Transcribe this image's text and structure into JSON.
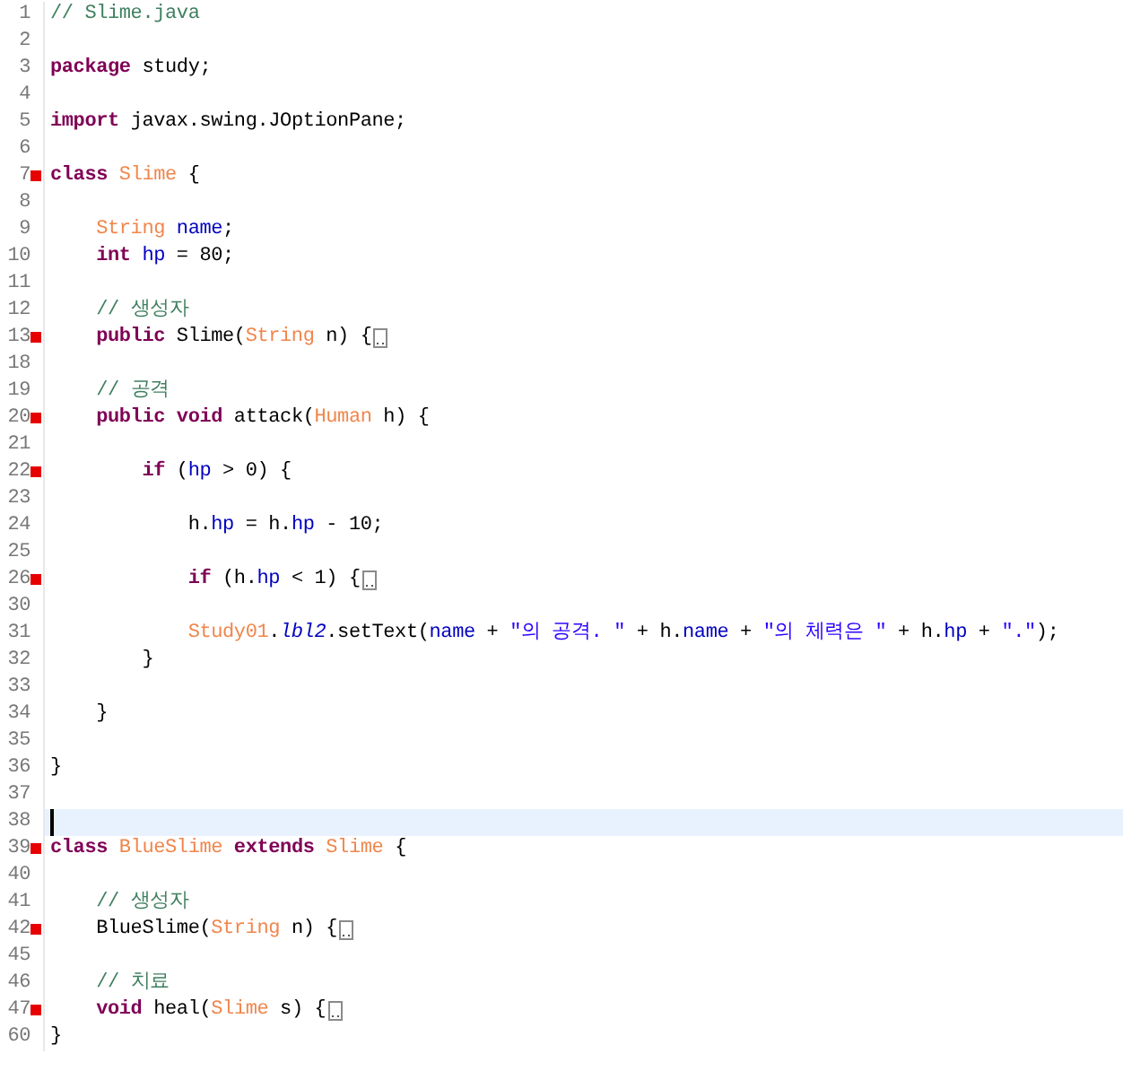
{
  "lines": [
    {
      "number": "1",
      "tokens": [
        {
          "text": "// Slime.java",
          "kind": "comment"
        }
      ]
    },
    {
      "number": "2"
    },
    {
      "number": "3",
      "tokens": [
        {
          "text": "package",
          "kind": "keyword"
        },
        {
          "text": " study;",
          "kind": "plain"
        }
      ]
    },
    {
      "number": "4"
    },
    {
      "number": "5",
      "tokens": [
        {
          "text": "import",
          "kind": "keyword"
        },
        {
          "text": " javax.swing.JOptionPane;",
          "kind": "plain"
        }
      ]
    },
    {
      "number": "6"
    },
    {
      "number": "7",
      "marker": true,
      "tokens": [
        {
          "text": "class",
          "kind": "keyword"
        },
        {
          "text": " Slime",
          "kind": "type"
        },
        {
          "text": " {",
          "kind": "plain"
        }
      ]
    },
    {
      "number": "8"
    },
    {
      "number": "9",
      "tokens": [
        {
          "text": "    String",
          "kind": "type"
        },
        {
          "text": " name",
          "kind": "field"
        },
        {
          "text": ";",
          "kind": "plain"
        }
      ]
    },
    {
      "number": "10",
      "tokens": [
        {
          "text": "    int",
          "kind": "keyword"
        },
        {
          "text": " hp",
          "kind": "field"
        },
        {
          "text": " = 80;",
          "kind": "plain"
        }
      ]
    },
    {
      "number": "11"
    },
    {
      "number": "12",
      "tokens": [
        {
          "text": "    // 생성자",
          "kind": "comment"
        }
      ]
    },
    {
      "number": "13",
      "marker": true,
      "folded": true,
      "tokens": [
        {
          "text": "    public",
          "kind": "keyword"
        },
        {
          "text": " Slime(",
          "kind": "plain"
        },
        {
          "text": "String",
          "kind": "type"
        },
        {
          "text": " n) {",
          "kind": "plain"
        }
      ]
    },
    {
      "number": "18"
    },
    {
      "number": "19",
      "tokens": [
        {
          "text": "    // 공격",
          "kind": "comment"
        }
      ]
    },
    {
      "number": "20",
      "marker": true,
      "tokens": [
        {
          "text": "    public",
          "kind": "keyword"
        },
        {
          "text": " void",
          "kind": "keyword"
        },
        {
          "text": " attack(",
          "kind": "plain"
        },
        {
          "text": "Human",
          "kind": "type"
        },
        {
          "text": " h) {",
          "kind": "plain"
        }
      ]
    },
    {
      "number": "21"
    },
    {
      "number": "22",
      "marker": true,
      "tokens": [
        {
          "text": "        if",
          "kind": "keyword"
        },
        {
          "text": " (",
          "kind": "plain"
        },
        {
          "text": "hp",
          "kind": "field"
        },
        {
          "text": " > 0) {",
          "kind": "plain"
        }
      ]
    },
    {
      "number": "23"
    },
    {
      "number": "24",
      "tokens": [
        {
          "text": "            h.",
          "kind": "plain"
        },
        {
          "text": "hp",
          "kind": "field"
        },
        {
          "text": " = h.",
          "kind": "plain"
        },
        {
          "text": "hp",
          "kind": "field"
        },
        {
          "text": " - 10;",
          "kind": "plain"
        }
      ]
    },
    {
      "number": "25"
    },
    {
      "number": "26",
      "marker": true,
      "folded": true,
      "tokens": [
        {
          "text": "            if",
          "kind": "keyword"
        },
        {
          "text": " (h.",
          "kind": "plain"
        },
        {
          "text": "hp",
          "kind": "field"
        },
        {
          "text": " < 1) {",
          "kind": "plain"
        }
      ]
    },
    {
      "number": "30"
    },
    {
      "number": "31",
      "tokens": [
        {
          "text": "            Study01",
          "kind": "type"
        },
        {
          "text": ".",
          "kind": "plain"
        },
        {
          "text": "lbl2",
          "kind": "static"
        },
        {
          "text": ".setText(",
          "kind": "plain"
        },
        {
          "text": "name",
          "kind": "field"
        },
        {
          "text": " + ",
          "kind": "plain"
        },
        {
          "text": "\"의 공격. \"",
          "kind": "string"
        },
        {
          "text": " + h.",
          "kind": "plain"
        },
        {
          "text": "name",
          "kind": "field"
        },
        {
          "text": " + ",
          "kind": "plain"
        },
        {
          "text": "\"의 체력은 \"",
          "kind": "string"
        },
        {
          "text": " + h.",
          "kind": "plain"
        },
        {
          "text": "hp",
          "kind": "field"
        },
        {
          "text": " + ",
          "kind": "plain"
        },
        {
          "text": "\".\"",
          "kind": "string"
        },
        {
          "text": ");",
          "kind": "plain"
        }
      ]
    },
    {
      "number": "32",
      "tokens": [
        {
          "text": "        }",
          "kind": "plain"
        }
      ]
    },
    {
      "number": "33"
    },
    {
      "number": "34",
      "tokens": [
        {
          "text": "    }",
          "kind": "plain"
        }
      ]
    },
    {
      "number": "35"
    },
    {
      "number": "36",
      "tokens": [
        {
          "text": "}",
          "kind": "plain"
        }
      ]
    },
    {
      "number": "37"
    },
    {
      "number": "38",
      "current": true
    },
    {
      "number": "39",
      "marker": true,
      "tokens": [
        {
          "text": "class",
          "kind": "keyword"
        },
        {
          "text": " BlueSlime",
          "kind": "type"
        },
        {
          "text": " extends",
          "kind": "keyword"
        },
        {
          "text": " Slime",
          "kind": "type"
        },
        {
          "text": " {",
          "kind": "plain"
        }
      ]
    },
    {
      "number": "40"
    },
    {
      "number": "41",
      "tokens": [
        {
          "text": "    // 생성자",
          "kind": "comment"
        }
      ]
    },
    {
      "number": "42",
      "marker": true,
      "folded": true,
      "tokens": [
        {
          "text": "    BlueSlime(",
          "kind": "plain"
        },
        {
          "text": "String",
          "kind": "type"
        },
        {
          "text": " n) {",
          "kind": "plain"
        }
      ]
    },
    {
      "number": "45"
    },
    {
      "number": "46",
      "tokens": [
        {
          "text": "    // 치료",
          "kind": "comment"
        }
      ]
    },
    {
      "number": "47",
      "marker": true,
      "folded": true,
      "tokens": [
        {
          "text": "    void",
          "kind": "keyword"
        },
        {
          "text": " heal(",
          "kind": "plain"
        },
        {
          "text": "Slime",
          "kind": "type"
        },
        {
          "text": " s) {",
          "kind": "plain"
        }
      ]
    },
    {
      "number": "60",
      "tokens": [
        {
          "text": "}",
          "kind": "plain"
        }
      ]
    }
  ]
}
